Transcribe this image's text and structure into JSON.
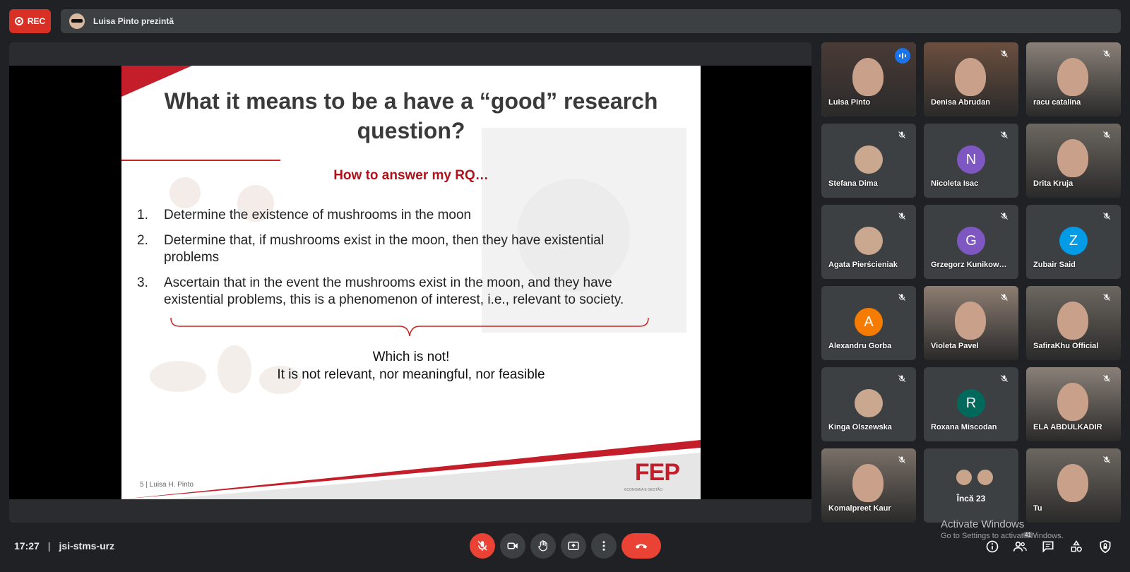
{
  "top_bar": {
    "rec_label": "REC",
    "presenter_text": "Luisa Pinto prezintă"
  },
  "slide": {
    "title": "What it means to be a have a “good” research question?",
    "subtitle": "How to answer my RQ…",
    "items": [
      {
        "num": "1.",
        "text": "Determine the existence of mushrooms in the moon"
      },
      {
        "num": "2.",
        "text": "Determine that, if mushrooms exist in the moon, then they have existential problems"
      },
      {
        "num": "3.",
        "text": "Ascertain that in the event the mushrooms exist in the moon, and they have existential problems, this is a phenomenon of interest, i.e., relevant to society."
      }
    ],
    "conclusion_line1": "Which is not!",
    "conclusion_line2": "It is not relevant, nor meaningful, nor feasible",
    "footer": "5 | Luisa H. Pinto",
    "logo": "FEP",
    "logo_sub": "ECONOMIA E GESTÃO"
  },
  "participants": [
    {
      "name": "Luisa Pinto",
      "type": "video",
      "speaking": true
    },
    {
      "name": "Denisa Abrudan",
      "type": "video",
      "muted": true
    },
    {
      "name": "racu catalina",
      "type": "video",
      "muted": true
    },
    {
      "name": "Stefana Dima",
      "type": "photo",
      "muted": true
    },
    {
      "name": "Nicoleta Isac",
      "type": "letter",
      "letter": "N",
      "color": "#7e57c2",
      "muted": true
    },
    {
      "name": "Drita Kruja",
      "type": "video",
      "muted": true
    },
    {
      "name": "Agata Pierścieniak",
      "type": "photo",
      "muted": true
    },
    {
      "name": "Grzegorz Kunikow…",
      "type": "letter",
      "letter": "G",
      "color": "#7e57c2",
      "muted": true
    },
    {
      "name": "Zubair Said",
      "type": "letter",
      "letter": "Z",
      "color": "#039be5",
      "muted": true
    },
    {
      "name": "Alexandru Gorba",
      "type": "letter",
      "letter": "A",
      "color": "#f57c00",
      "muted": true
    },
    {
      "name": "Violeta Pavel",
      "type": "video",
      "muted": true
    },
    {
      "name": "SafiraKhu Official",
      "type": "video",
      "muted": true
    },
    {
      "name": "Kinga Olszewska",
      "type": "photo",
      "muted": true
    },
    {
      "name": "Roxana Miscodan",
      "type": "letter",
      "letter": "R",
      "color": "#00695c",
      "muted": true
    },
    {
      "name": "ELA ABDULKADIR",
      "type": "video",
      "muted": true
    },
    {
      "name": "Komalpreet Kaur",
      "type": "video",
      "muted": true
    },
    {
      "name": "Încă 23",
      "type": "more"
    },
    {
      "name": "Tu",
      "type": "video",
      "muted": true
    }
  ],
  "bottom_bar": {
    "time": "17:27",
    "separator": "|",
    "meeting_code": "jsi-stms-urz",
    "participant_count": "41"
  },
  "watermark": {
    "line1": "Activate Windows",
    "line2": "Go to Settings to activate Windows."
  },
  "colors": {
    "accent": "#8ab4f8",
    "danger": "#ea4335",
    "rec": "#d93025",
    "slide_red": "#b0121b"
  }
}
